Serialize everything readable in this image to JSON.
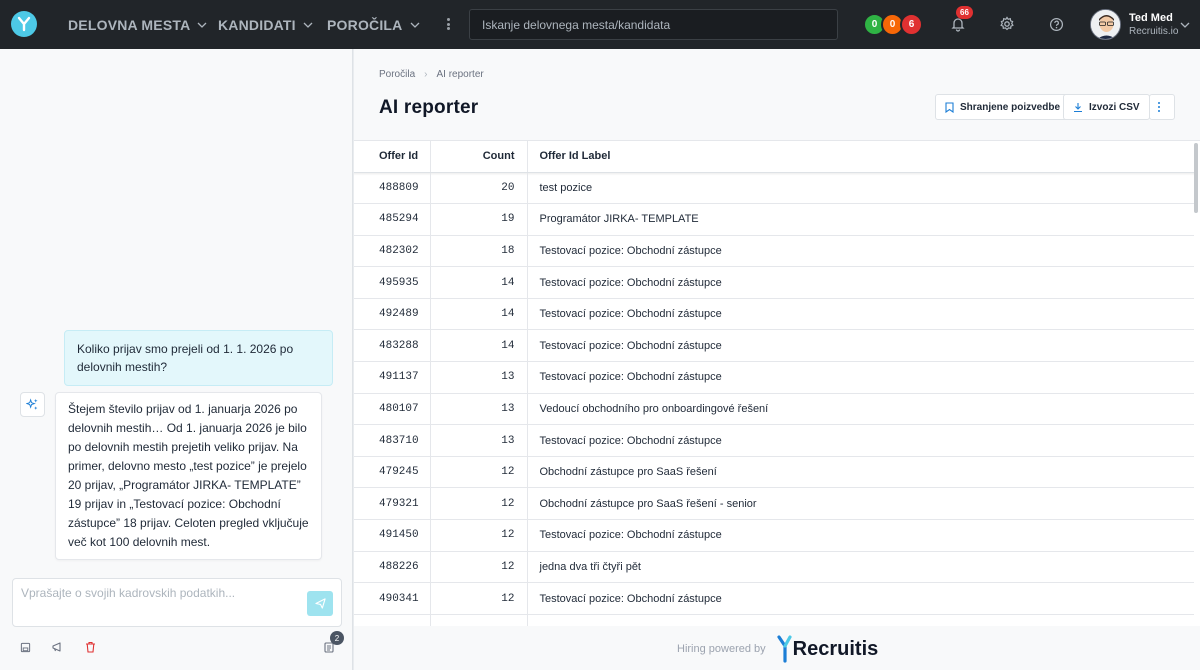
{
  "topbar": {
    "nav": [
      {
        "label": "DELOVNA MESTA"
      },
      {
        "label": "KANDIDATI"
      },
      {
        "label": "POROČILA"
      }
    ],
    "search_placeholder": "Iskanje delovnega mesta/kandidata",
    "status_badges": [
      {
        "value": "0",
        "color": "#2fb344"
      },
      {
        "value": "0",
        "color": "#f76707"
      },
      {
        "value": "6",
        "color": "#e03131"
      }
    ],
    "notifications_count": "66",
    "user": {
      "name": "Ted Med",
      "org": "Recruitis.io"
    }
  },
  "chat": {
    "user_message": "Koliko prijav smo prejeli od 1. 1. 2026 po delovnih mestih?",
    "ai_message": "Štejem število prijav od 1. januarja 2026 po delovnih mestih… Od 1. januarja 2026 je bilo po delovnih mestih prejetih veliko prijav. Na primer, delovno mesto „test pozice” je prejelo 20 prijav, „Programátor JIRKA- TEMPLATE” 19 prijav in „Testovací pozice: Obchodní zástupce” 18 prijav. Celoten pregled vključuje več kot 100 delovnih mest.",
    "input_placeholder": "Vprašajte o svojih kadrovskih podatkih...",
    "history_count": "2"
  },
  "main": {
    "breadcrumb": [
      "Poročila",
      "AI reporter"
    ],
    "title": "AI reporter",
    "save_query_label": "Shranjene poizvedbe",
    "export_csv_label": "Izvozi CSV",
    "table": {
      "headers": [
        "Offer Id",
        "Count",
        "Offer Id Label"
      ],
      "rows": [
        [
          "488809",
          "20",
          "test pozice"
        ],
        [
          "485294",
          "19",
          "Programátor JIRKA- TEMPLATE"
        ],
        [
          "482302",
          "18",
          "Testovací pozice: Obchodní zástupce"
        ],
        [
          "495935",
          "14",
          "Testovací pozice: Obchodní zástupce"
        ],
        [
          "492489",
          "14",
          "Testovací pozice: Obchodní zástupce"
        ],
        [
          "483288",
          "14",
          "Testovací pozice: Obchodní zástupce"
        ],
        [
          "491137",
          "13",
          "Testovací pozice: Obchodní zástupce"
        ],
        [
          "480107",
          "13",
          "Vedoucí obchodního pro onboardingové řešení"
        ],
        [
          "483710",
          "13",
          "Testovací pozice: Obchodní zástupce"
        ],
        [
          "479245",
          "12",
          "Obchodní zástupce pro SaaS řešení"
        ],
        [
          "479321",
          "12",
          "Obchodní zástupce pro SaaS řešení - senior"
        ],
        [
          "491450",
          "12",
          "Testovací pozice: Obchodní zástupce"
        ],
        [
          "488226",
          "12",
          "jedna dva tři čtyři pět"
        ],
        [
          "490341",
          "12",
          "Testovací pozice: Obchodní zástupce"
        ],
        [
          "",
          "",
          ""
        ]
      ]
    },
    "footer_text": "Hiring powered by",
    "brand_name": "Recruitis"
  }
}
